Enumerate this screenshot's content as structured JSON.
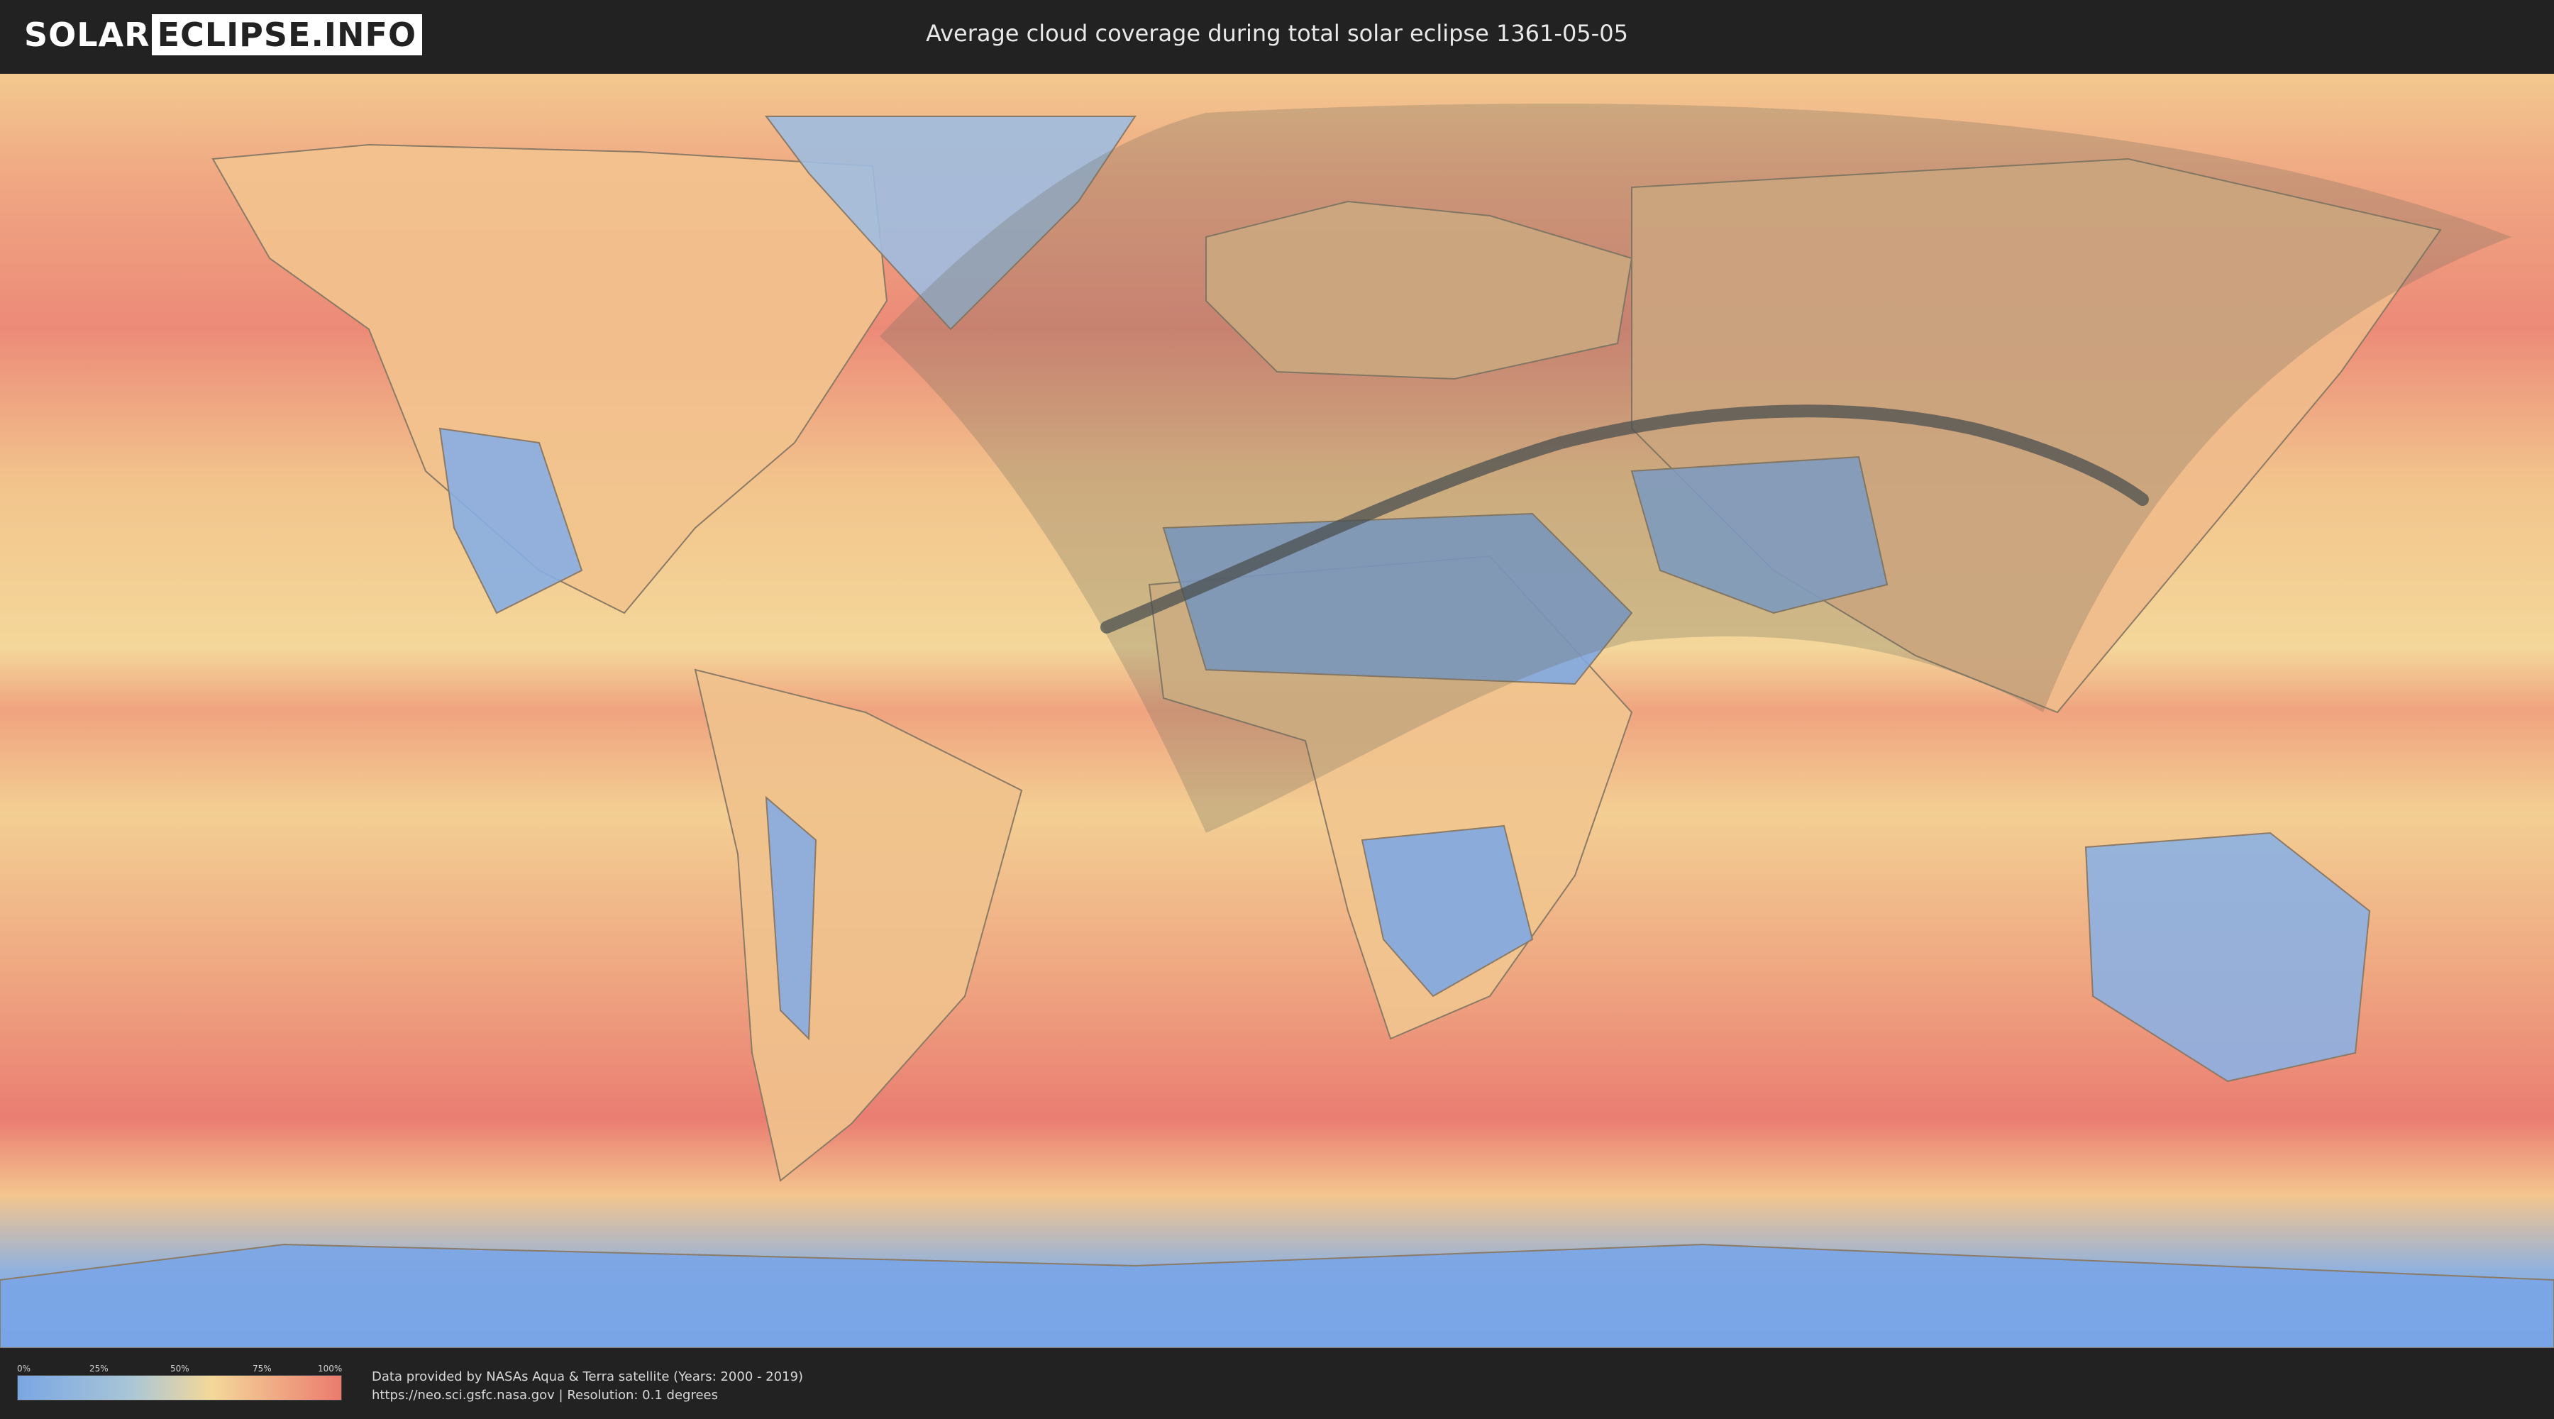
{
  "header": {
    "logo_part1": "SOLAR",
    "logo_part2": "ECLIPSE.INFO",
    "title": "Average cloud coverage during total solar eclipse 1361-05-05"
  },
  "map": {
    "icon": "world-cloud-map",
    "colors": {
      "clear": "#7aa6e3",
      "low": "#a9c6d6",
      "mid": "#f4d89a",
      "high": "#ec7b6e",
      "shadow": "#6b6a5c",
      "path": "#4b4f4f"
    }
  },
  "footer": {
    "legend_ticks": [
      "0%",
      "25%",
      "50%",
      "75%",
      "100%"
    ],
    "credit_line1": "Data provided by NASAs Aqua & Terra satellite (Years: 2000 - 2019)",
    "credit_line2": "https://neo.sci.gsfc.nasa.gov | Resolution: 0.1 degrees"
  }
}
